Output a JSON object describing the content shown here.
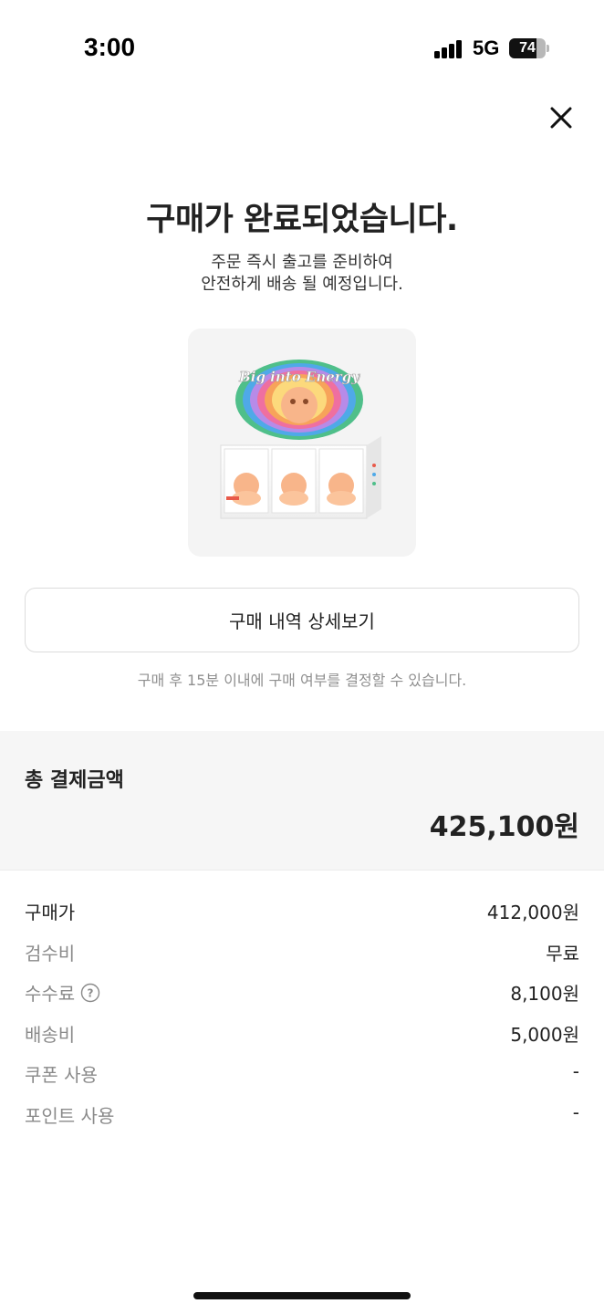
{
  "status_bar": {
    "time": "3:00",
    "network": "5G",
    "battery_level": "74"
  },
  "header": {
    "close_icon": "close-icon"
  },
  "main": {
    "title": "구매가 완료되었습니다.",
    "subtitle_line1": "주문 즉시 출고를 준비하여",
    "subtitle_line2": "안전하게 배송 될 예정입니다.",
    "product_image_text": "Big into Energy",
    "detail_button_label": "구매 내역 상세보기",
    "notice": "구매 후 15분 이내에 구매 여부를 결정할 수 있습니다."
  },
  "total": {
    "label": "총 결제금액",
    "value": "425,100원"
  },
  "breakdown": [
    {
      "label": "구매가",
      "value": "412,000원"
    },
    {
      "label": "검수비",
      "value": "무료"
    },
    {
      "label": "수수료",
      "value": "8,100원"
    },
    {
      "label": "배송비",
      "value": "5,000원"
    },
    {
      "label": "쿠폰 사용",
      "value": "-"
    },
    {
      "label": "포인트 사용",
      "value": "-"
    }
  ],
  "colors": {
    "background": "#ffffff",
    "section_bg": "#f6f6f6",
    "muted_text": "#8a8a8a",
    "primary_text": "#222222"
  }
}
